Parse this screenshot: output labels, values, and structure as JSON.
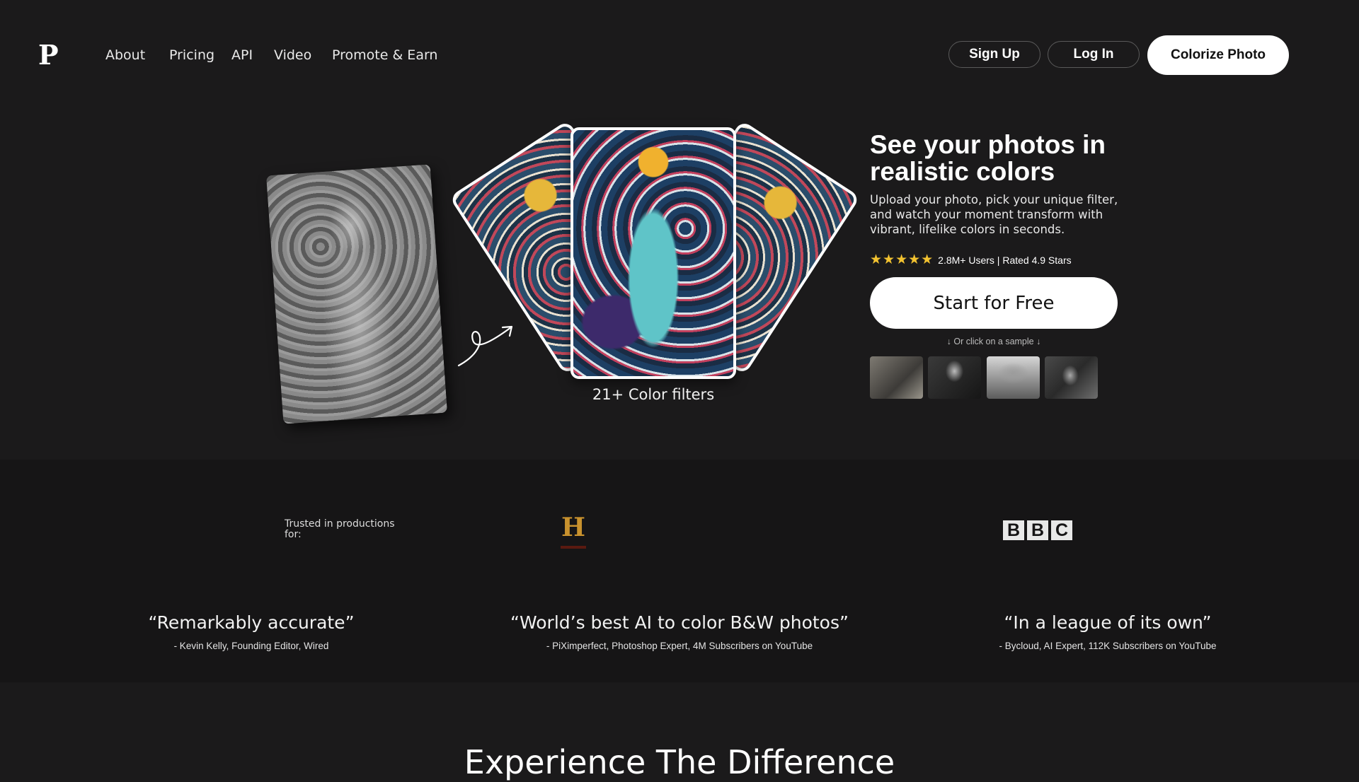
{
  "header": {
    "logo": "P",
    "nav": [
      "About",
      "Pricing",
      "API",
      "Video",
      "Promote & Earn"
    ],
    "signup_label": "Sign Up",
    "login_label": "Log In",
    "cta_label": "Colorize Photo"
  },
  "hero": {
    "filters_label": "21+ Color filters",
    "title": "See your photos in realistic colors",
    "subtitle": "Upload your photo, pick your unique filter, and watch your moment transform with vibrant, lifelike colors in seconds.",
    "rating_stars": 5,
    "rating_text": "2.8M+ Users | Rated 4.9 Stars",
    "start_label": "Start for Free",
    "sample_hint": "↓  Or click on a sample  ↓",
    "samples": [
      "sample-photo-1",
      "sample-photo-2",
      "sample-photo-3",
      "sample-photo-4"
    ]
  },
  "trusted": {
    "label": "Trusted in productions for:",
    "logos": [
      "history-channel-logo",
      "bbc-logo"
    ],
    "bbc_letters": [
      "B",
      "B",
      "C"
    ],
    "history_letter": "H"
  },
  "testimonials": [
    {
      "quote": "“Remarkably accurate”",
      "author": "- Kevin Kelly, Founding Editor, Wired"
    },
    {
      "quote": "“World’s best AI to color B&W photos”",
      "author": "- PiXimperfect, Photoshop Expert, 4M Subscribers on YouTube"
    },
    {
      "quote": "“In a league of its own”",
      "author": "- Bycloud, AI Expert, 112K Subscribers on YouTube"
    }
  ],
  "section_heading": "Experience The Difference",
  "colors": {
    "background": "#1b1a1b",
    "band": "#161516",
    "star": "#f2c230",
    "button_bg": "#ffffff"
  }
}
